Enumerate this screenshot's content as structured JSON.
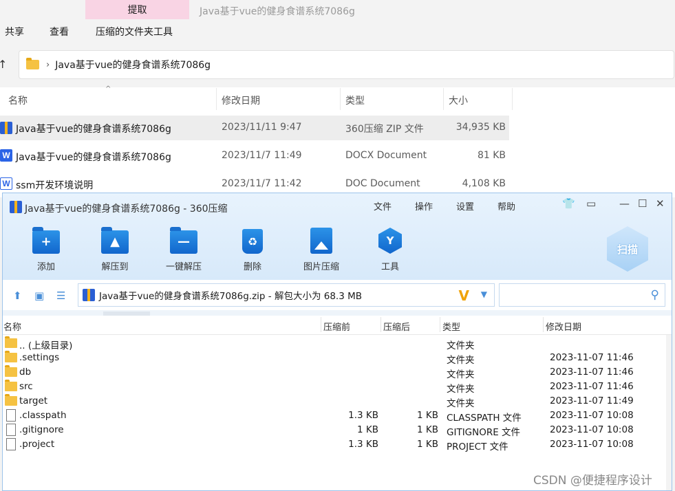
{
  "explorer": {
    "context_tab": "提取",
    "title": "Java基于vue的健身食谱系统7086g",
    "ribbon_tabs": [
      "共享",
      "查看",
      "压缩的文件夹工具"
    ],
    "address_path": "Java基于vue的健身食谱系统7086g",
    "columns": {
      "name": "名称",
      "modified": "修改日期",
      "type": "类型",
      "size": "大小"
    },
    "files": [
      {
        "icon": "zip-archive-icon",
        "name": "Java基于vue的健身食谱系统7086g",
        "modified": "2023/11/11 9:47",
        "type": "360压缩 ZIP 文件",
        "size": "34,935 KB",
        "selected": true
      },
      {
        "icon": "word-docx-icon",
        "name": "Java基于vue的健身食谱系统7086g",
        "modified": "2023/11/7 11:49",
        "type": "DOCX Document",
        "size": "81 KB",
        "selected": false
      },
      {
        "icon": "word-doc-icon",
        "name": "ssm开发环境说明",
        "modified": "2023/11/7 11:42",
        "type": "DOC Document",
        "size": "4,108 KB",
        "selected": false
      }
    ]
  },
  "zip_window": {
    "title": "Java基于vue的健身食谱系统7086g - 360压缩",
    "menu": [
      "文件",
      "操作",
      "设置",
      "帮助"
    ],
    "toolbar": [
      "添加",
      "解压到",
      "一键解压",
      "删除",
      "图片压缩",
      "工具"
    ],
    "scan_label": "扫描",
    "address_text": "Java基于vue的健身食谱系统7086g.zip - 解包大小为 68.3 MB",
    "columns": {
      "name": "名称",
      "before": "压缩前",
      "after": "压缩后",
      "type": "类型",
      "modified": "修改日期"
    },
    "entries": [
      {
        "icon": "folder-icon",
        "name": ".. (上级目录)",
        "before": "",
        "after": "",
        "type": "文件夹",
        "modified": ""
      },
      {
        "icon": "folder-icon",
        "name": ".settings",
        "before": "",
        "after": "",
        "type": "文件夹",
        "modified": "2023-11-07 11:46"
      },
      {
        "icon": "folder-icon",
        "name": "db",
        "before": "",
        "after": "",
        "type": "文件夹",
        "modified": "2023-11-07 11:46"
      },
      {
        "icon": "folder-icon",
        "name": "src",
        "before": "",
        "after": "",
        "type": "文件夹",
        "modified": "2023-11-07 11:46"
      },
      {
        "icon": "folder-icon",
        "name": "target",
        "before": "",
        "after": "",
        "type": "文件夹",
        "modified": "2023-11-07 11:49"
      },
      {
        "icon": "file-icon",
        "name": ".classpath",
        "before": "1.3 KB",
        "after": "1 KB",
        "type": "CLASSPATH 文件",
        "modified": "2023-11-07 10:08"
      },
      {
        "icon": "file-icon",
        "name": ".gitignore",
        "before": "1 KB",
        "after": "1 KB",
        "type": "GITIGNORE 文件",
        "modified": "2023-11-07 10:08"
      },
      {
        "icon": "file-icon",
        "name": ".project",
        "before": "1.3 KB",
        "after": "1 KB",
        "type": "PROJECT 文件",
        "modified": "2023-11-07 10:08"
      }
    ]
  },
  "watermark": "CSDN @便捷程序设计"
}
